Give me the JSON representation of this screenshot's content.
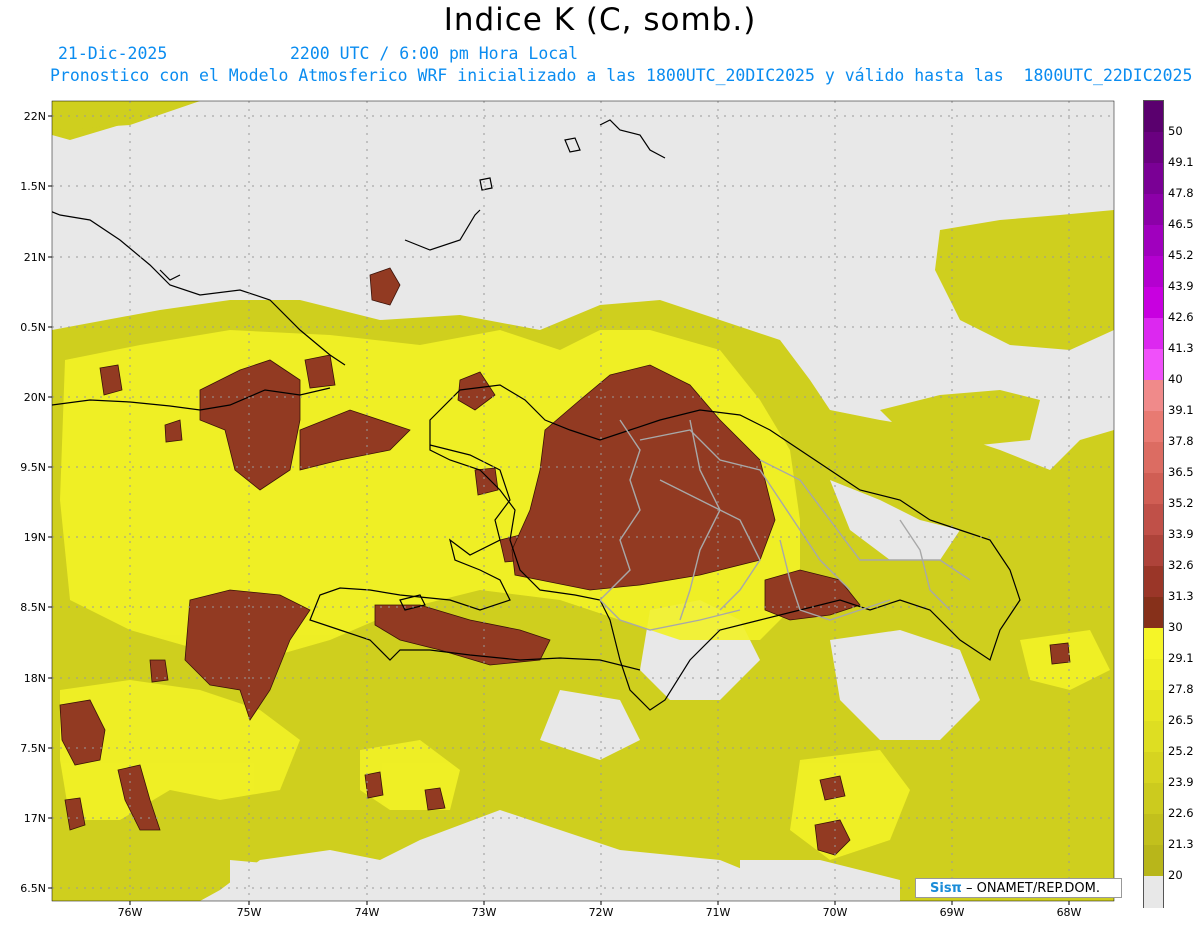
{
  "header": {
    "title": "Indice K (C, somb.)",
    "date": "21-Dic-2025",
    "time": "2200 UTC / 6:00 pm Hora Local",
    "run_info": "Pronostico con el Modelo Atmosferico WRF inicializado a las 1800UTC_20DIC2025 y válido hasta las  1800UTC_22DIC2025"
  },
  "map": {
    "lon_labels": [
      "76W",
      "75W",
      "74W",
      "73W",
      "72W",
      "71W",
      "70W",
      "69W",
      "68W"
    ],
    "lat_labels": [
      "22N",
      "1.5N",
      "21N",
      "0.5N",
      "20N",
      "9.5N",
      "19N",
      "8.5N",
      "18N",
      "7.5N",
      "17N",
      "6.5N"
    ],
    "background_color": "#e8e8e8"
  },
  "colorbar": {
    "labels": [
      "50",
      "49.1",
      "47.8",
      "46.5",
      "45.2",
      "43.9",
      "42.6",
      "41.3",
      "40",
      "39.1",
      "37.8",
      "36.5",
      "35.2",
      "33.9",
      "32.6",
      "31.3",
      "30",
      "29.1",
      "27.8",
      "26.5",
      "25.2",
      "23.9",
      "22.6",
      "21.3",
      "20"
    ],
    "colors": [
      "#5a006e",
      "#6a0080",
      "#7a0095",
      "#8c00a8",
      "#a000be",
      "#b400d0",
      "#c800e0",
      "#dc28f0",
      "#f050fa",
      "#f08a8a",
      "#e87a72",
      "#dc6c62",
      "#d05e54",
      "#c05048",
      "#ae433a",
      "#9a3628",
      "#86301a",
      "#f5f528",
      "#eeee24",
      "#e6e622",
      "#dede22",
      "#d6d420",
      "#cccb1e",
      "#c2c01c",
      "#b8b61a",
      "#e8e8e8"
    ]
  },
  "credit": {
    "logo": "Sisπ",
    "text": " – ONAMET/REP.DOM."
  }
}
